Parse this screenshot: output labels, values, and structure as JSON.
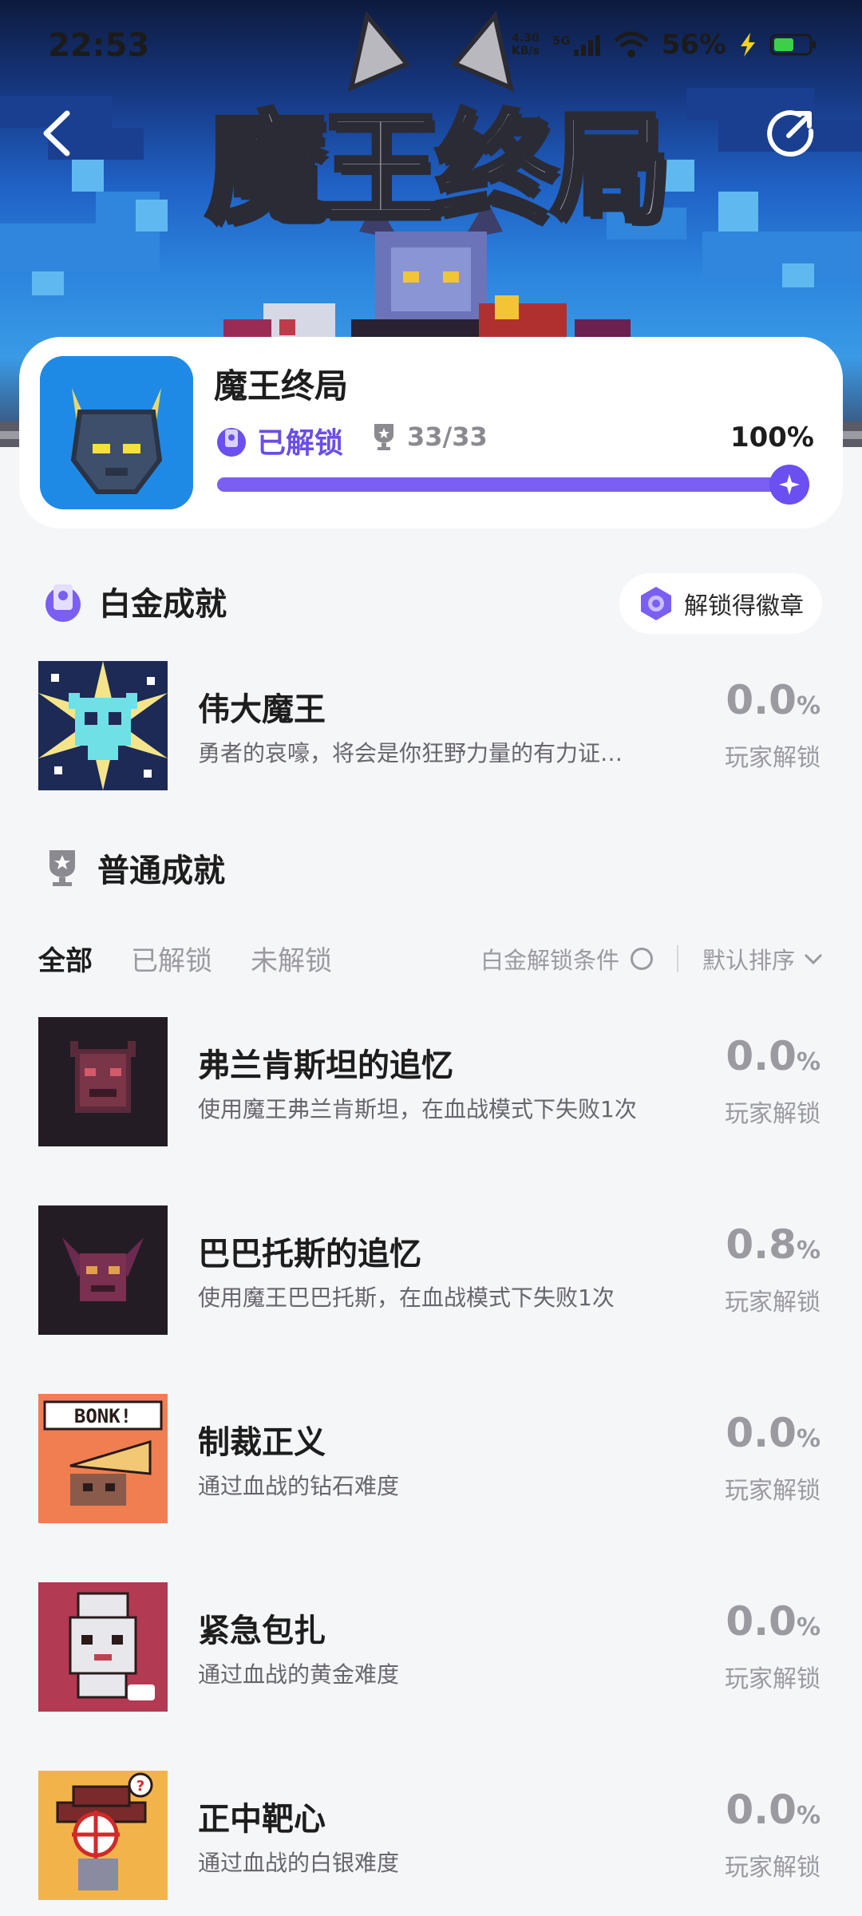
{
  "status_bar": {
    "time": "22:53",
    "net_speed_value": "4.30",
    "net_speed_unit": "KB/s",
    "network": "5G",
    "battery": "56%"
  },
  "hero": {
    "logo_text": "魔王终局"
  },
  "game": {
    "name": "魔王终局",
    "status": "已解锁",
    "trophy_count": "33/33",
    "percent": "100%",
    "progress": 1.0
  },
  "platinum": {
    "title": "白金成就",
    "badge_button": "解锁得徽章",
    "item": {
      "name": "伟大魔王",
      "desc": "勇者的哀嚎，将会是你狂野力量的有力证…",
      "pct": "0.0",
      "pct_unit": "%",
      "sub": "玩家解锁"
    }
  },
  "normal": {
    "title": "普通成就",
    "tabs": [
      "全部",
      "已解锁",
      "未解锁"
    ],
    "filter_label": "白金解锁条件",
    "sort_label": "默认排序",
    "items": [
      {
        "name": "弗兰肯斯坦的追忆",
        "desc": "使用魔王弗兰肯斯坦，在血战模式下失败1次",
        "pct": "0.0",
        "pct_unit": "%",
        "sub": "玩家解锁"
      },
      {
        "name": "巴巴托斯的追忆",
        "desc": "使用魔王巴巴托斯，在血战模式下失败1次",
        "pct": "0.8",
        "pct_unit": "%",
        "sub": "玩家解锁"
      },
      {
        "name": "制裁正义",
        "desc": "通过血战的钻石难度",
        "pct": "0.0",
        "pct_unit": "%",
        "sub": "玩家解锁"
      },
      {
        "name": "紧急包扎",
        "desc": "通过血战的黄金难度",
        "pct": "0.0",
        "pct_unit": "%",
        "sub": "玩家解锁"
      },
      {
        "name": "正中靶心",
        "desc": "通过血战的白银难度",
        "pct": "0.0",
        "pct_unit": "%",
        "sub": "玩家解锁"
      }
    ],
    "art_labels": {
      "bonk": "BONK!"
    }
  },
  "colors": {
    "accent": "#6b4ff0",
    "muted": "#9a9aa0",
    "bg": "#f5f6f8"
  }
}
